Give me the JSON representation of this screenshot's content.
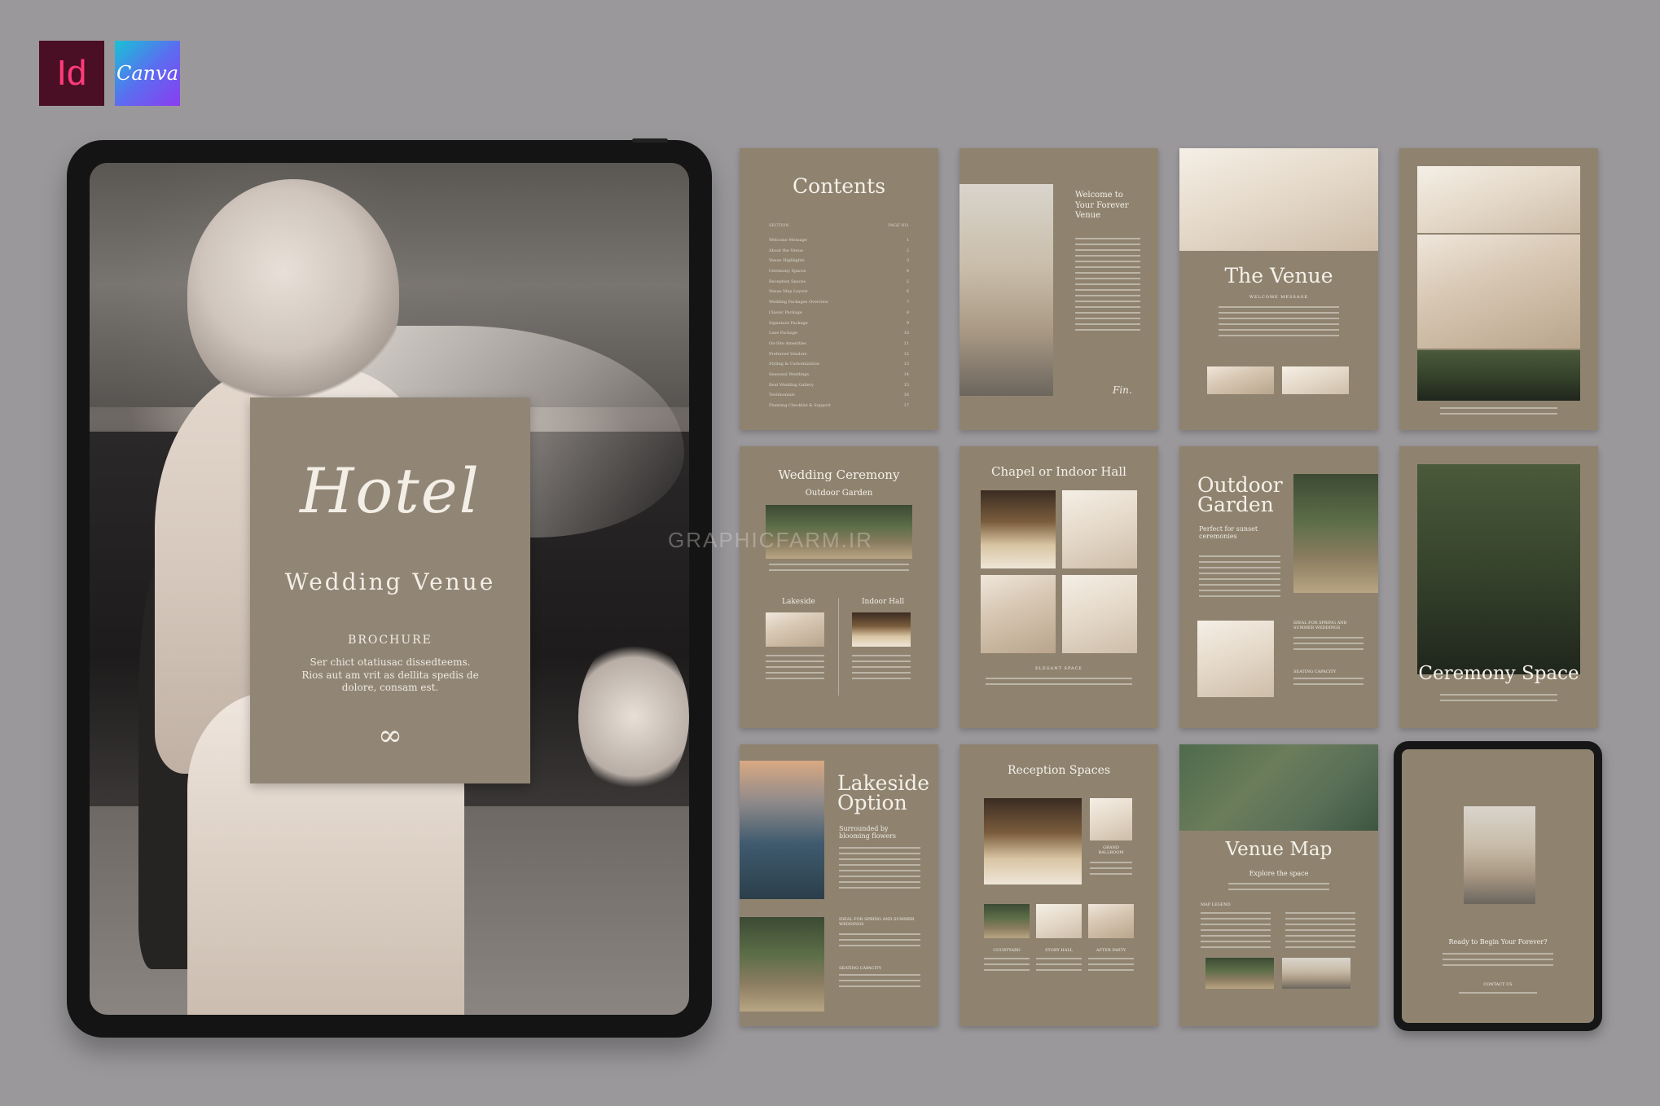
{
  "badges": {
    "indesign": "Id",
    "canva": "Canva"
  },
  "cover": {
    "script_title": "Hotel",
    "title": "Wedding Venue",
    "label": "BROCHURE",
    "description": "Ser chict otatiusac dissedteems. Rios aut am vrit as dellita spedis de dolore, consam est.",
    "flourish": "∞"
  },
  "pages": {
    "contents": {
      "title": "Contents",
      "col_section": "SECTION",
      "col_page": "PAGE NO.",
      "items": [
        "Welcome Message",
        "About the Venue",
        "Venue Highlights",
        "Ceremony Spaces",
        "Reception Spaces",
        "Venue Map Layout",
        "Wedding Packages Overview",
        "Classic Package",
        "Signature Package",
        "Luxe Package",
        "On-Site Amenities",
        "Preferred Vendors",
        "Styling & Customization",
        "Seasonal Weddings",
        "Real Wedding Gallery",
        "Testimonials",
        "Planning Checklist & Support"
      ]
    },
    "welcome": {
      "title": "Welcome to Your Forever Venue",
      "signature": "Fin."
    },
    "venue": {
      "title": "The Venue",
      "subtitle": "WELCOME MESSAGE"
    },
    "ceremony": {
      "title": "Wedding Ceremony",
      "subtitle": "Outdoor Garden",
      "left_label": "Lakeside",
      "right_label": "Indoor Hall"
    },
    "chapel": {
      "title": "Chapel or Indoor Hall",
      "caption": "ELEGANT SPACE"
    },
    "outdoor": {
      "title_line1": "Outdoor",
      "title_line2": "Garden",
      "subtitle": "Perfect for sunset ceremonies",
      "label1": "IDEAL FOR SPRING AND SUMMER WEDDINGS",
      "label2": "SEATING CAPACITY"
    },
    "ceremony_space": {
      "title": "Ceremony Space"
    },
    "lakeside": {
      "title_line1": "Lakeside",
      "title_line2": "Option",
      "subtitle": "Surrounded by blooming flowers",
      "label1": "IDEAL FOR SPRING AND SUMMER WEDDINGS",
      "label2": "SEATING CAPACITY"
    },
    "reception": {
      "title": "Reception Spaces",
      "side_label": "GRAND BALLROOM",
      "captions": [
        "COURTYARD",
        "STORY HALL",
        "AFTER PARTY"
      ]
    },
    "map": {
      "title": "Venue Map",
      "subtitle": "Explore the space",
      "label": "MAP LEGEND"
    },
    "final": {
      "title": "Ready to Begin Your Forever?",
      "contact": "CONTACT US"
    }
  },
  "watermark": "GRAPHICFARM.IR"
}
